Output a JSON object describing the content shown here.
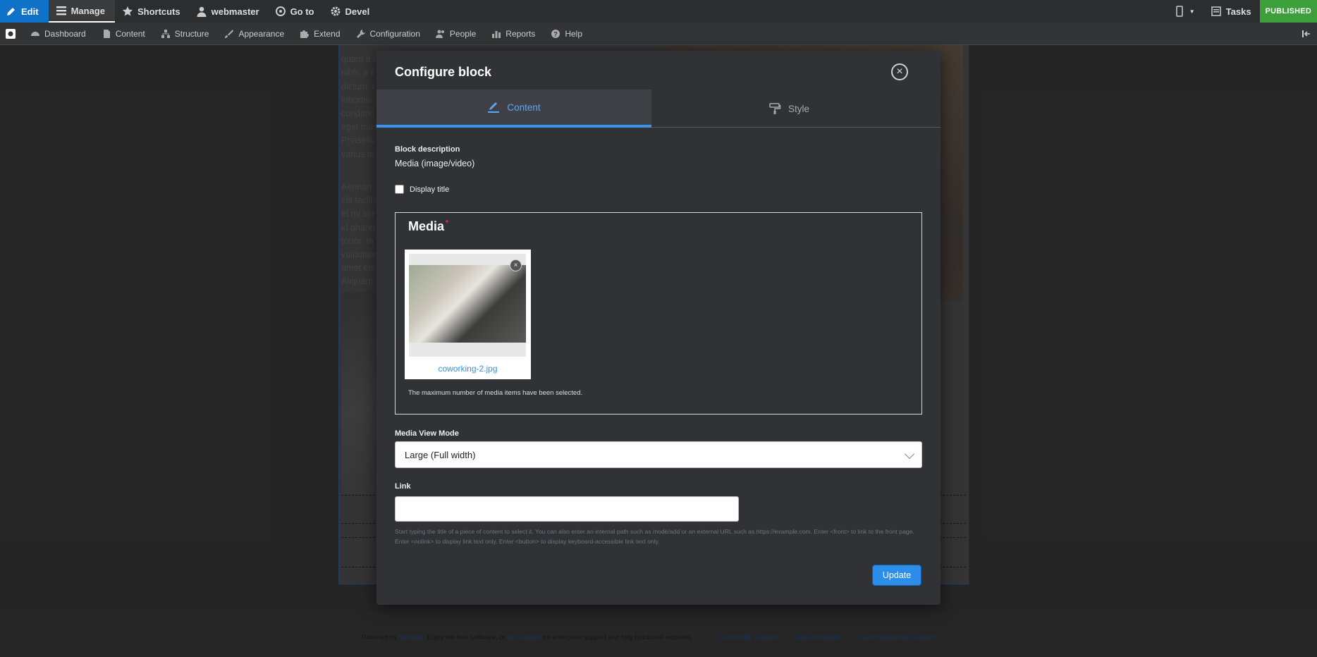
{
  "toolbar": {
    "edit": "Edit",
    "manage": "Manage",
    "shortcuts": "Shortcuts",
    "user": "webmaster",
    "goto": "Go to",
    "devel": "Devel",
    "tasks": "Tasks",
    "status": "PUBLISHED"
  },
  "tray": {
    "items": [
      "Dashboard",
      "Content",
      "Structure",
      "Appearance",
      "Extend",
      "Configuration",
      "People",
      "Reports",
      "Help"
    ]
  },
  "background": {
    "paragraph_1": "quam a congue. Nam pretium id sem et pharetra. Pellentesque eu convallis\nnibh, a s\ndictum, i\nlobortis.\ncondime\neget mas\nPhasellu\nvarius m",
    "paragraph_2": "Aenean\nelit facilis\net mi ser\nid pharet\ntortor. In\nvulputate\namet eni\nAliquam\nblandit v\nsollicitud"
  },
  "footer": {
    "powered_prefix": "Powered by ",
    "powered_link": "Varbase",
    "powered_mid": ". Enjoy the free software, or ",
    "quote_link": "get a quote",
    "powered_suffix": " for enterprise support and fully functional websites.",
    "links": [
      "Community Support",
      "Documentation",
      "Get Professional Support"
    ]
  },
  "dialog": {
    "title": "Configure block",
    "close": "×",
    "tabs": [
      {
        "label": "Content",
        "icon": "pencil-icon",
        "active": true
      },
      {
        "label": "Style",
        "icon": "paint-roller-icon",
        "active": false
      }
    ],
    "block_description_label": "Block description",
    "block_description_value": "Media (image/video)",
    "display_title_label": "Display title",
    "display_title_checked": false,
    "media": {
      "legend": "Media",
      "required_marker": "*",
      "filename": "coworking-2.jpg",
      "remove": "×",
      "max_notice": "The maximum number of media items have been selected."
    },
    "view_mode_label": "Media View Mode",
    "view_mode_value": "Large (Full width)",
    "link_label": "Link",
    "link_value": "",
    "link_help": "Start typing the title of a piece of content to select it. You can also enter an internal path such as /node/add or an external URL such as https://example.com. Enter <front> to link to the front page. Enter <nolink> to display link text only. Enter <button> to display keyboard-accessible link text only.",
    "update_label": "Update"
  },
  "colors": {
    "accent": "#2d8ee9",
    "tab_active": "#5aa8f3",
    "published": "#3d9f3a",
    "edit": "#0f71c7"
  }
}
